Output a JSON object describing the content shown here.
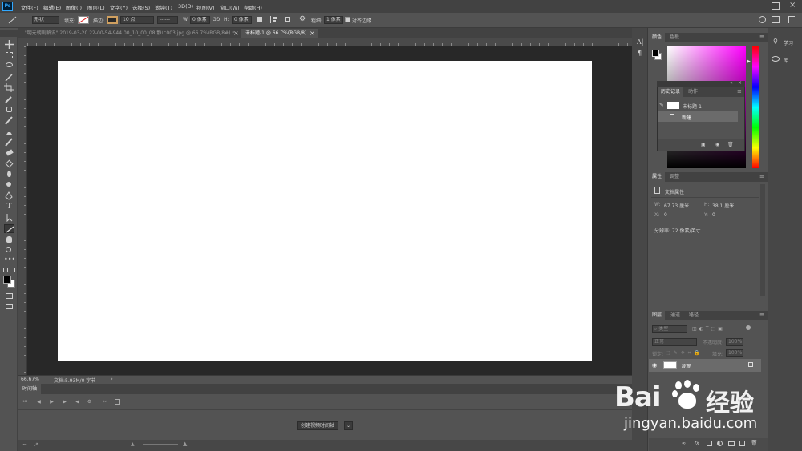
{
  "menu": [
    "文件(F)",
    "编辑(E)",
    "图像(I)",
    "图层(L)",
    "文字(Y)",
    "选择(S)",
    "滤镜(T)",
    "3D(D)",
    "视图(V)",
    "窗口(W)",
    "帮助(H)"
  ],
  "app_logo": "Ps",
  "options": {
    "shape_mode": "形状",
    "fill_label": "填充:",
    "stroke_label": "描边:",
    "stroke_width": "10 点",
    "w_label": "W:",
    "w_value": "0 像素",
    "link_label": "GĐ",
    "h_label": "H:",
    "h_value": "0 像素",
    "weight_label": "粗细:",
    "weight_value": "1 像素",
    "align_edges_label": "对齐边缘"
  },
  "tabs": [
    {
      "label": "\"明元朝剧解说\" 2019-03-20 22-00-54-944.00_10_00_08.静止003.jpg @ 66.7%(RGB/8#) *",
      "active": false
    },
    {
      "label": "未标题-1 @ 66.7%(RGB/8)",
      "active": true
    }
  ],
  "tab_close": "×",
  "status": {
    "zoom": "66.67%",
    "doc": "文档:5.93M/0 字节"
  },
  "timeline": {
    "title": "时间轴",
    "create_button": "创建视频时间轴"
  },
  "color_panel": {
    "tabs": [
      "颜色",
      "色板"
    ]
  },
  "history_panel": {
    "tabs": [
      "历史记录",
      "动作"
    ],
    "items": [
      {
        "label": "未标题-1",
        "type": "snapshot"
      },
      {
        "label": "新建",
        "type": "state"
      }
    ]
  },
  "properties_panel": {
    "tabs": [
      "属性",
      "调整"
    ],
    "section": "文档属性",
    "w_label": "W:",
    "w_value": "67.73 厘米",
    "h_label": "H:",
    "h_value": "38.1 厘米",
    "x_label": "X:",
    "x_value": "0",
    "y_label": "Y:",
    "y_value": "0",
    "resolution": "分辨率: 72 像素/英寸"
  },
  "layers_panel": {
    "tabs": [
      "图层",
      "通道",
      "路径"
    ],
    "filter_kind": "类型",
    "blend_mode": "正常",
    "opacity_label": "不透明度:",
    "opacity_value": "100%",
    "lock_label": "锁定:",
    "fill_label": "填充:",
    "fill_value": "100%",
    "layers": [
      {
        "name": "背景"
      }
    ],
    "footer_icons": [
      "link-icon",
      "fx-icon",
      "mask-icon",
      "adjustment-icon",
      "group-icon",
      "new-layer-icon",
      "trash-icon"
    ]
  },
  "right_column": {
    "learn": "学习",
    "library": "库"
  },
  "watermark": {
    "brand": "Bai",
    "brand2": "经验",
    "url": "jingyan.baidu.com"
  },
  "colors": {
    "canvas": "#ffffff",
    "pasteboard": "#282828",
    "ui": "#535353",
    "accent": "#31a8ff"
  }
}
